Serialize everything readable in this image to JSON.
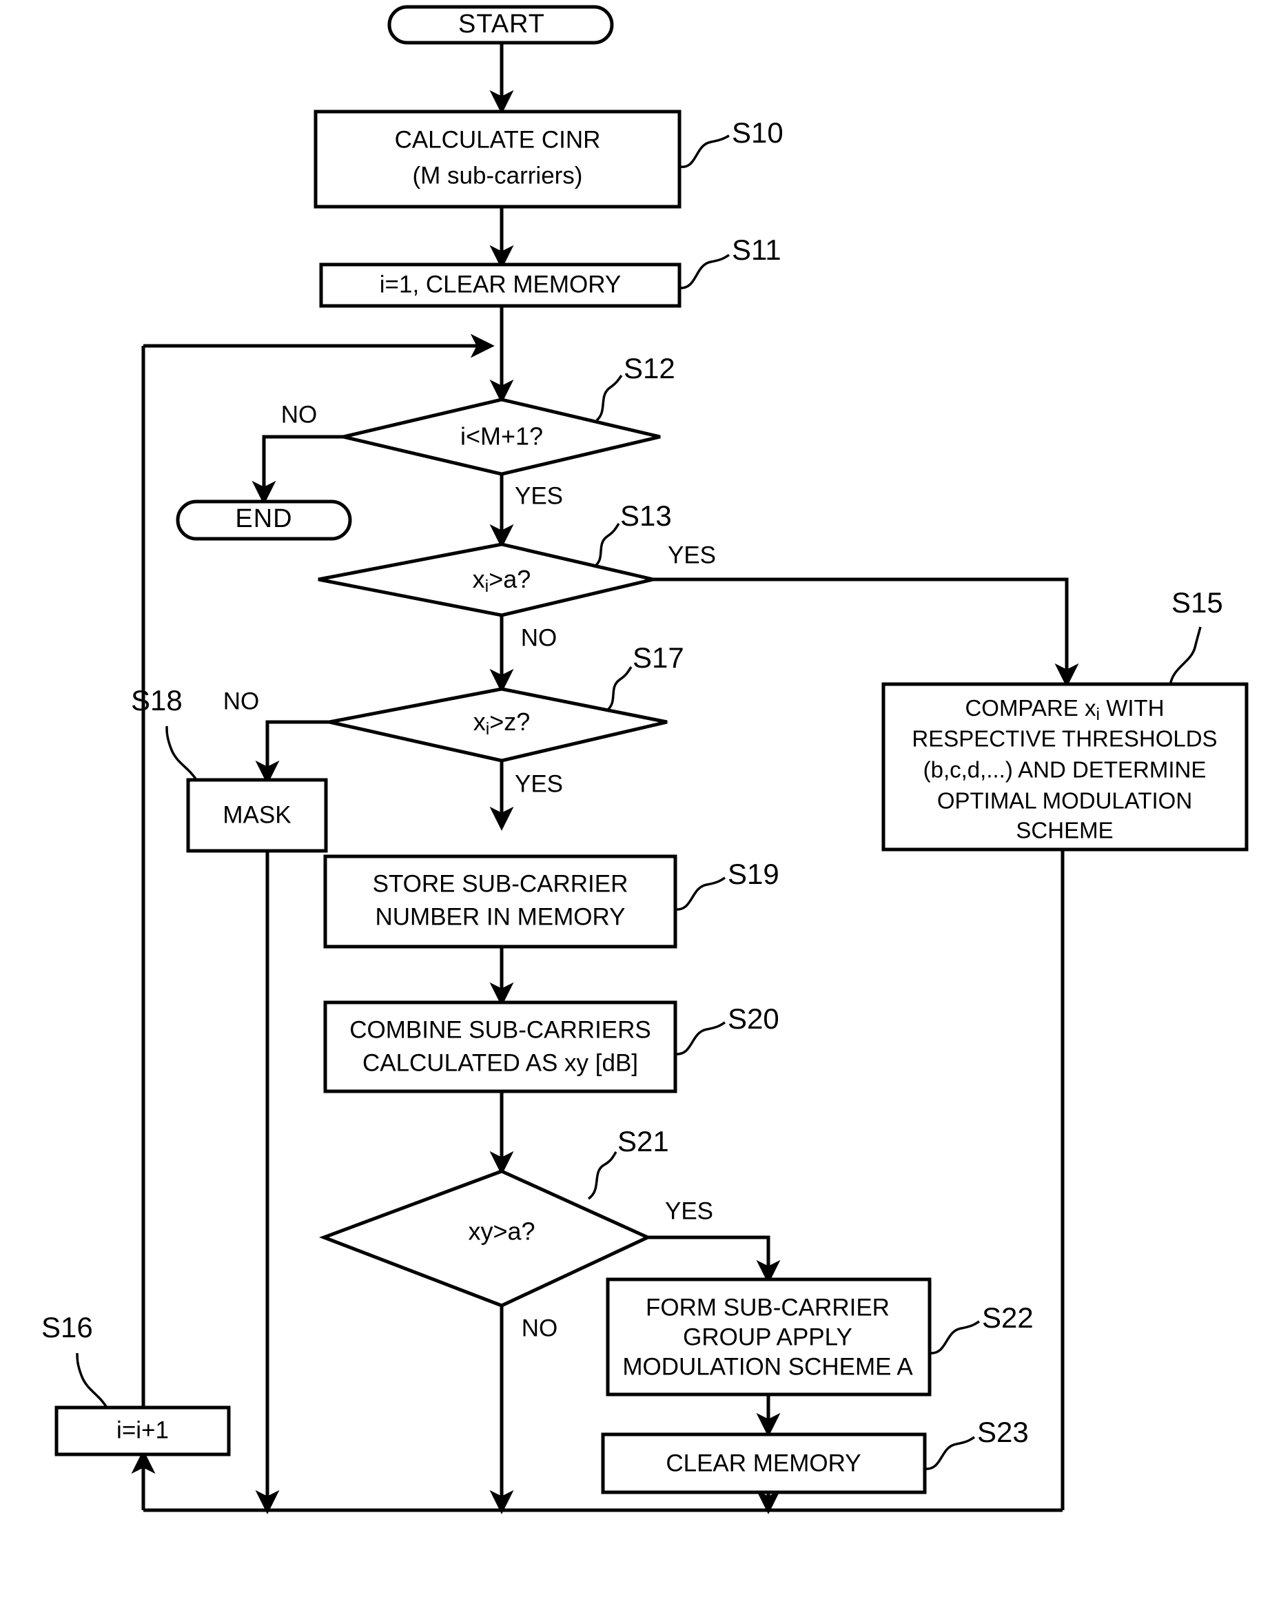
{
  "diagram": {
    "type": "flowchart",
    "title": "",
    "terminators": {
      "start": "START",
      "end": "END"
    },
    "nodes": [
      {
        "id": "S10",
        "step": "S10",
        "kind": "process",
        "lines": [
          "CALCULATE CINR",
          "(M sub-carriers)"
        ]
      },
      {
        "id": "S11",
        "step": "S11",
        "kind": "process",
        "lines": [
          "i=1, CLEAR MEMORY"
        ]
      },
      {
        "id": "S12",
        "step": "S12",
        "kind": "decision",
        "lines": [
          "i<M+1?"
        ],
        "yes": "YES",
        "no": "NO"
      },
      {
        "id": "S13",
        "step": "S13",
        "kind": "decision",
        "lines": [
          "xi>a?"
        ],
        "text_main": "x",
        "text_sub": "i",
        "text_tail": ">a?",
        "yes": "YES",
        "no": "NO"
      },
      {
        "id": "S15",
        "step": "S15",
        "kind": "process",
        "lines": [
          "COMPARE xi WITH",
          "RESPECTIVE THRESHOLDS",
          "(b,c,d,...) AND DETERMINE",
          "OPTIMAL MODULATION",
          "SCHEME"
        ]
      },
      {
        "id": "S16",
        "step": "S16",
        "kind": "process",
        "lines": [
          "i=i+1"
        ]
      },
      {
        "id": "S17",
        "step": "S17",
        "kind": "decision",
        "lines": [
          "xi>z?"
        ],
        "text_main": "x",
        "text_sub": "i",
        "text_tail": ">z?",
        "yes": "YES",
        "no": "NO"
      },
      {
        "id": "S18",
        "step": "S18",
        "kind": "process",
        "lines": [
          "MASK"
        ]
      },
      {
        "id": "S19",
        "step": "S19",
        "kind": "process",
        "lines": [
          "STORE SUB-CARRIER",
          "NUMBER IN MEMORY"
        ]
      },
      {
        "id": "S20",
        "step": "S20",
        "kind": "process",
        "lines": [
          "COMBINE SUB-CARRIERS",
          "CALCULATED AS xy [dB]"
        ]
      },
      {
        "id": "S21",
        "step": "S21",
        "kind": "decision",
        "lines": [
          "xy>a?"
        ],
        "yes": "YES",
        "no": "NO"
      },
      {
        "id": "S22",
        "step": "S22",
        "kind": "process",
        "lines": [
          "FORM SUB-CARRIER",
          "GROUP APPLY",
          "MODULATION SCHEME A"
        ]
      },
      {
        "id": "S23",
        "step": "S23",
        "kind": "process",
        "lines": [
          "CLEAR MEMORY"
        ]
      }
    ],
    "labels": {
      "start": "START",
      "end": "END",
      "s10_l1": "CALCULATE CINR",
      "s10_l2": "(M sub-carriers)",
      "s10_tag": "S10",
      "s11_l1": "i=1, CLEAR MEMORY",
      "s11_tag": "S11",
      "s12_cond": "i<M+1?",
      "s12_tag": "S12",
      "s12_no": "NO",
      "s12_yes": "YES",
      "s13_cond_main": "x",
      "s13_cond_sub": "i",
      "s13_cond_tail": ">a?",
      "s13_tag": "S13",
      "s13_yes": "YES",
      "s13_no": "NO",
      "s15_l1_a": "COMPARE x",
      "s15_l1_sub": "i",
      "s15_l1_b": " WITH",
      "s15_l2": "RESPECTIVE THRESHOLDS",
      "s15_l3": "(b,c,d,...) AND DETERMINE",
      "s15_l4": "OPTIMAL MODULATION",
      "s15_l5": "SCHEME",
      "s15_tag": "S15",
      "s16_l1": "i=i+1",
      "s16_tag": "S16",
      "s17_cond_main": "x",
      "s17_cond_sub": "i",
      "s17_cond_tail": ">z?",
      "s17_tag": "S17",
      "s17_no": "NO",
      "s17_yes": "YES",
      "s18_l1": "MASK",
      "s18_tag": "S18",
      "s19_l1": "STORE SUB-CARRIER",
      "s19_l2": "NUMBER IN MEMORY",
      "s19_tag": "S19",
      "s20_l1": "COMBINE SUB-CARRIERS",
      "s20_l2": "CALCULATED AS xy [dB]",
      "s20_tag": "S20",
      "s21_cond": "xy>a?",
      "s21_tag": "S21",
      "s21_yes": "YES",
      "s21_no": "NO",
      "s22_l1": "FORM SUB-CARRIER",
      "s22_l2": "GROUP APPLY",
      "s22_l3": "MODULATION SCHEME A",
      "s22_tag": "S22",
      "s23_l1": "CLEAR MEMORY",
      "s23_tag": "S23"
    },
    "colors": {
      "stroke": "#000000",
      "fill": "#ffffff",
      "background": "#ffffff"
    }
  }
}
